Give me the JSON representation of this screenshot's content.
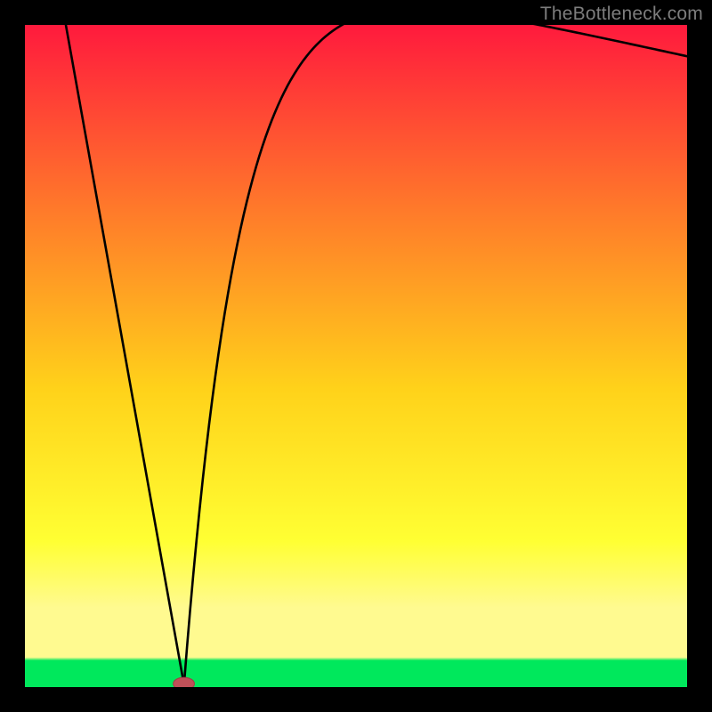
{
  "attribution": "TheBottleneck.com",
  "colors": {
    "frame": "#000000",
    "grad_top": "#ff1a3d",
    "grad_mid1": "#ff7a2a",
    "grad_mid2": "#ffd21a",
    "grad_yel": "#ffff33",
    "grad_band": "#fffa90",
    "grad_green": "#00e85c",
    "curve": "#000000",
    "marker_fill": "#c05058",
    "marker_stroke": "#a33e47"
  },
  "chart_data": {
    "type": "line",
    "title": "",
    "xlabel": "",
    "ylabel": "",
    "xlim": [
      0,
      100
    ],
    "ylim": [
      0,
      100
    ],
    "min_x": 24,
    "left_branch": {
      "x0": 6,
      "y0": 101,
      "x1": 24,
      "y1": 0.5
    },
    "right_branch": {
      "a": 112,
      "b": 8.5,
      "y_asymptote_shown_at_xmax": 87
    },
    "marker": {
      "x": 24,
      "y": 0.5,
      "rx": 1.6,
      "ry": 0.95
    },
    "annotations": []
  }
}
